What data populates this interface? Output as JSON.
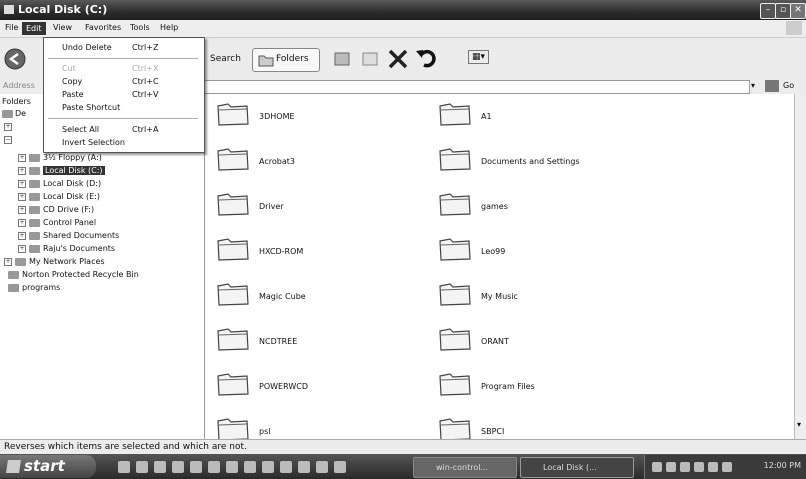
{
  "window": {
    "title": "Local Disk (C:)",
    "controls": {
      "minimize": "–",
      "maximize": "▫",
      "close": "✕"
    }
  },
  "menubar": {
    "items": [
      "File",
      "Edit",
      "View",
      "Favorites",
      "Tools",
      "Help"
    ],
    "active": "Edit"
  },
  "toolbar": {
    "search_label": "Search",
    "folders_label": "Folders",
    "views_label": "▦▾"
  },
  "address": {
    "label": "Address",
    "go_label": "Go"
  },
  "edit_menu": {
    "items": [
      {
        "label": "Undo Delete",
        "shortcut": "Ctrl+Z",
        "enabled": true
      },
      {
        "label": "Cut",
        "shortcut": "Ctrl+X",
        "enabled": false
      },
      {
        "label": "Copy",
        "shortcut": "Ctrl+C",
        "enabled": true
      },
      {
        "label": "Paste",
        "shortcut": "Ctrl+V",
        "enabled": true
      },
      {
        "label": "Paste Shortcut",
        "shortcut": "",
        "enabled": true
      },
      {
        "label": "Select All",
        "shortcut": "Ctrl+A",
        "enabled": true
      },
      {
        "label": "Invert Selection",
        "shortcut": "",
        "enabled": true
      }
    ]
  },
  "folders_pane": {
    "header": "Folders",
    "partial": [
      "De"
    ],
    "items": [
      {
        "label": "3½ Floppy (A:)",
        "icon": "floppy-icon",
        "selected": false
      },
      {
        "label": "Local Disk (C:)",
        "icon": "drive-icon",
        "selected": true
      },
      {
        "label": "Local Disk (D:)",
        "icon": "drive-icon",
        "selected": false
      },
      {
        "label": "Local Disk (E:)",
        "icon": "drive-icon",
        "selected": false
      },
      {
        "label": "CD Drive (F:)",
        "icon": "cd-icon",
        "selected": false
      },
      {
        "label": "Control Panel",
        "icon": "control-panel-icon",
        "selected": false
      },
      {
        "label": "Shared Documents",
        "icon": "folder-icon",
        "selected": false
      },
      {
        "label": "Raju's Documents",
        "icon": "folder-icon",
        "selected": false
      },
      {
        "label": "My Network Places",
        "icon": "network-icon",
        "selected": false
      },
      {
        "label": "Norton Protected Recycle Bin",
        "icon": "recycle-bin-icon",
        "selected": false
      },
      {
        "label": "programs",
        "icon": "folder-icon",
        "selected": false
      }
    ]
  },
  "files": [
    "3DHOME",
    "A1",
    "Acrobat3",
    "Documents and Settings",
    "Driver",
    "games",
    "HXCD-ROM",
    "Leo99",
    "Magic Cube",
    "My Music",
    "NCDTREE",
    "ORANT",
    "POWERWCD",
    "Program Files",
    "psl",
    "SBPCI"
  ],
  "status": {
    "text": "Reverses which items are selected and which are not."
  },
  "taskbar": {
    "start": "start",
    "tasks": [
      "win-control...",
      "Local Disk (..."
    ],
    "clock": "12:00 PM"
  }
}
